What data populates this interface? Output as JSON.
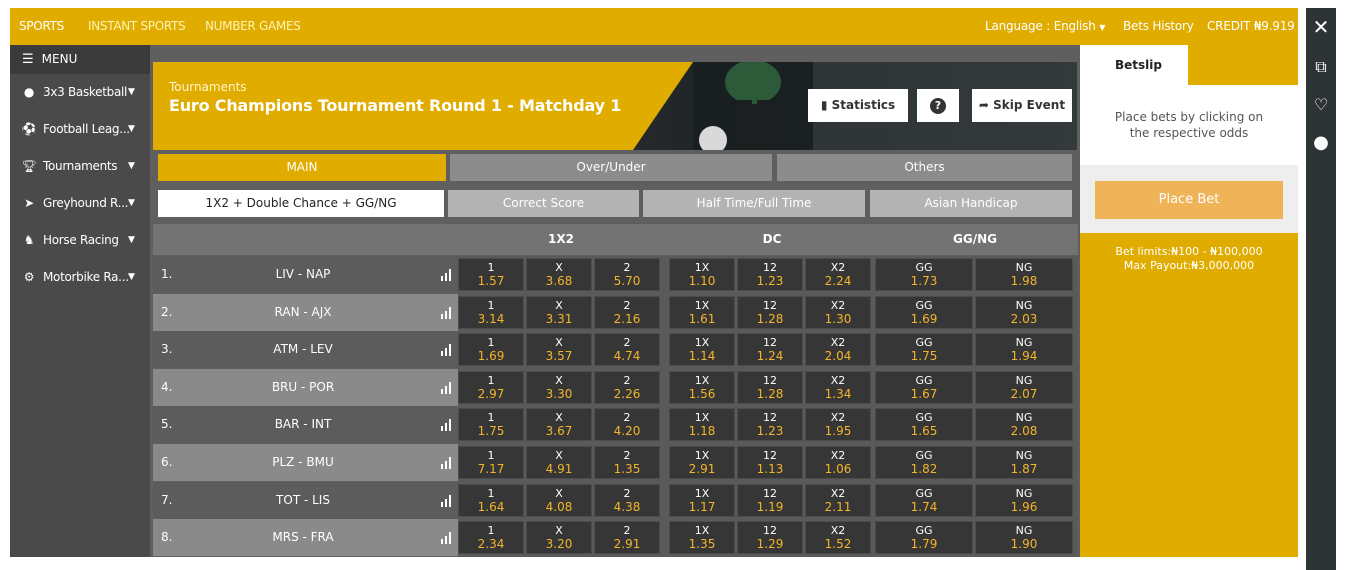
{
  "topbar": {
    "nav": [
      "SPORTS",
      "INSTANT SPORTS",
      "NUMBER GAMES"
    ],
    "language": "Language : English",
    "bets_history": "Bets History",
    "credit": "CREDIT ₦9.919"
  },
  "sidebar": {
    "menu_label": "MENU",
    "items": [
      {
        "label": "3x3 Basketball",
        "icon": "basketball-icon"
      },
      {
        "label": "Football Leag...",
        "icon": "football-icon"
      },
      {
        "label": "Tournaments",
        "icon": "trophy-icon"
      },
      {
        "label": "Greyhound R...",
        "icon": "greyhound-icon"
      },
      {
        "label": "Horse Racing",
        "icon": "horse-icon"
      },
      {
        "label": "Motorbike Ra...",
        "icon": "motorbike-icon"
      }
    ]
  },
  "banner": {
    "label": "Tournaments",
    "title": "Euro Champions Tournament Round 1 - Matchday 1",
    "statistics": "Statistics",
    "help": "?",
    "skip": "Skip Event"
  },
  "tabs": [
    "MAIN",
    "Over/Under",
    "Others"
  ],
  "subtabs": [
    "1X2 + Double Chance + GG/NG",
    "Correct Score",
    "Half Time/Full Time",
    "Asian Handicap"
  ],
  "grid_headers": [
    "1X2",
    "DC",
    "GG/NG"
  ],
  "odds_labels": [
    "1",
    "X",
    "2",
    "1X",
    "12",
    "X2",
    "GG",
    "NG"
  ],
  "matches": [
    {
      "num": "1.",
      "name": "LIV - NAP",
      "odds": [
        "1.57",
        "3.68",
        "5.70",
        "1.10",
        "1.23",
        "2.24",
        "1.73",
        "1.98"
      ]
    },
    {
      "num": "2.",
      "name": "RAN - AJX",
      "odds": [
        "3.14",
        "3.31",
        "2.16",
        "1.61",
        "1.28",
        "1.30",
        "1.69",
        "2.03"
      ]
    },
    {
      "num": "3.",
      "name": "ATM - LEV",
      "odds": [
        "1.69",
        "3.57",
        "4.74",
        "1.14",
        "1.24",
        "2.04",
        "1.75",
        "1.94"
      ]
    },
    {
      "num": "4.",
      "name": "BRU - POR",
      "odds": [
        "2.97",
        "3.30",
        "2.26",
        "1.56",
        "1.28",
        "1.34",
        "1.67",
        "2.07"
      ]
    },
    {
      "num": "5.",
      "name": "BAR - INT",
      "odds": [
        "1.75",
        "3.67",
        "4.20",
        "1.18",
        "1.23",
        "1.95",
        "1.65",
        "2.08"
      ]
    },
    {
      "num": "6.",
      "name": "PLZ - BMU",
      "odds": [
        "7.17",
        "4.91",
        "1.35",
        "2.91",
        "1.13",
        "1.06",
        "1.82",
        "1.87"
      ]
    },
    {
      "num": "7.",
      "name": "TOT - LIS",
      "odds": [
        "1.64",
        "4.08",
        "4.38",
        "1.17",
        "1.19",
        "2.11",
        "1.74",
        "1.96"
      ]
    },
    {
      "num": "8.",
      "name": "MRS - FRA",
      "odds": [
        "2.34",
        "3.20",
        "2.91",
        "1.35",
        "1.29",
        "1.52",
        "1.79",
        "1.90"
      ]
    }
  ],
  "betslip": {
    "tab": "Betslip",
    "hint": "Place bets by clicking on the respective odds",
    "place_bet": "Place Bet",
    "limits": "Bet limits:₦100 - ₦100,000",
    "max_payout": "Max Payout:₦3,000,000"
  },
  "colors": {
    "accent": "#e0ac00",
    "odds": "#f3b52a",
    "dark_cell": "#363636"
  }
}
